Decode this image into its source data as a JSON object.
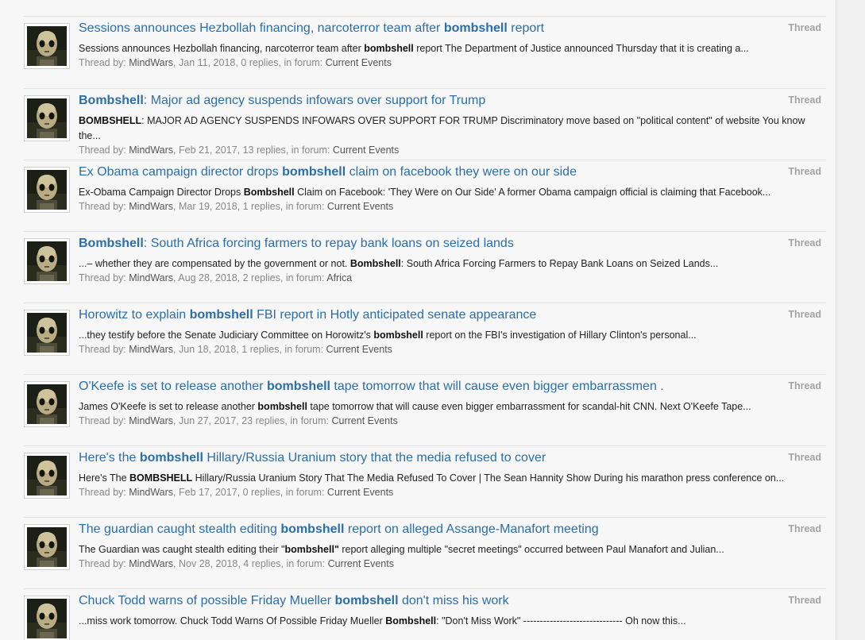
{
  "author": "MindWars",
  "type_label": "Thread",
  "meta": {
    "by_prefix": "Thread by:",
    "forum_prefix": ", in forum:"
  },
  "results": [
    {
      "title_pre": "Sessions announces Hezbollah financing, narcoterror team after ",
      "title_hl": "bombshell",
      "title_post": " report",
      "snippet_pre": "Sessions announces Hezbollah financing, narcoterror team after ",
      "snippet_hl": "bombshell",
      "snippet_post": " report The Department of Justice announced Thursday that it is creating a...",
      "date_stats": ", Jan 11, 2018, 0 replies",
      "forum": "Current Events"
    },
    {
      "title_pre": "",
      "title_hl": "Bombshell",
      "title_post": ": Major ad agency suspends infowars over support for Trump",
      "snippet_pre": "",
      "snippet_hl": "BOMBSHELL",
      "snippet_post": ": MAJOR AD AGENCY SUSPENDS INFOWARS OVER SUPPORT FOR TRUMP Discriminatory move based on \"political content\" of website You know the...",
      "date_stats": ", Feb 21, 2017, 13 replies",
      "forum": "Current Events"
    },
    {
      "title_pre": "Ex Obama campaign director drops ",
      "title_hl": "bombshell",
      "title_post": " claim on facebook they were on our side",
      "snippet_pre": "Ex-Obama Campaign Director Drops ",
      "snippet_hl": "Bombshell",
      "snippet_post": " Claim on Facebook: 'They Were on Our Side' A former Obama campaign official is claiming that Facebook...",
      "date_stats": ", Mar 19, 2018, 1 replies",
      "forum": "Current Events"
    },
    {
      "title_pre": "",
      "title_hl": "Bombshell",
      "title_post": ": South Africa forcing farmers to repay bank loans on seized lands",
      "snippet_pre": "...– whether they are compensated by the government or not. ",
      "snippet_hl": "Bombshell",
      "snippet_post": ": South Africa Forcing Farmers to Repay Bank Loans on Seized Lands...",
      "date_stats": ", Aug 28, 2018, 2 replies",
      "forum": "Africa"
    },
    {
      "title_pre": "Horowitz to explain ",
      "title_hl": "bombshell",
      "title_post": " FBI report in Hotly anticipated senate appearance",
      "snippet_pre": "...they testify before the Senate Judiciary Committee on Horowitz's ",
      "snippet_hl": "bombshell",
      "snippet_post": " report on the FBI's investigation of Hillary Clinton's personal...",
      "date_stats": ", Jun 18, 2018, 1 replies",
      "forum": "Current Events"
    },
    {
      "title_pre": "O'Keefe is set to release another ",
      "title_hl": "bombshell",
      "title_post": " tape tomorrow that will cause even bigger embarrassmen .",
      "snippet_pre": "James O'Keefe is set to release another ",
      "snippet_hl": "bombshell",
      "snippet_post": " tape tomorrow that will cause even bigger embarrassment for scandal-hit CNN. Next O'Keefe Tape...",
      "date_stats": ", Jun 27, 2017, 23 replies",
      "forum": "Current Events"
    },
    {
      "title_pre": "Here's the ",
      "title_hl": "bombshell",
      "title_post": " Hillary/Russia Uranium story that the media refused to cover",
      "snippet_pre": "Here's The ",
      "snippet_hl": "BOMBSHELL",
      "snippet_post": " Hillary/Russia Uranium Story That The Media Refused To Cover | The Sean Hannity Show During his marathon press conference on...",
      "date_stats": ", Feb 17, 2017, 0 replies",
      "forum": "Current Events"
    },
    {
      "title_pre": "The guardian caught stealth editing ",
      "title_hl": "bombshell",
      "title_post": " report on alleged Assange-Manafort meeting",
      "snippet_pre": "The Guardian was caught stealth editing their \"",
      "snippet_hl": "bombshell\"",
      "snippet_post": " report alleging multiple \"secret meetings\" occurred between Paul Manafort and Julian...",
      "date_stats": ", Nov 28, 2018, 4 replies",
      "forum": "Current Events"
    },
    {
      "title_pre": "Chuck Todd warns of possible Friday Mueller ",
      "title_hl": "bombshell",
      "title_post": " don't miss his work",
      "snippet_pre": "...miss work tomorrow. Chuck Todd Warns Of Possible Friday Mueller ",
      "snippet_hl": "Bombshell",
      "snippet_post": ": \"Don't Miss Work\" ------------------------------ Oh now this...",
      "date_stats": "",
      "forum": ""
    }
  ]
}
